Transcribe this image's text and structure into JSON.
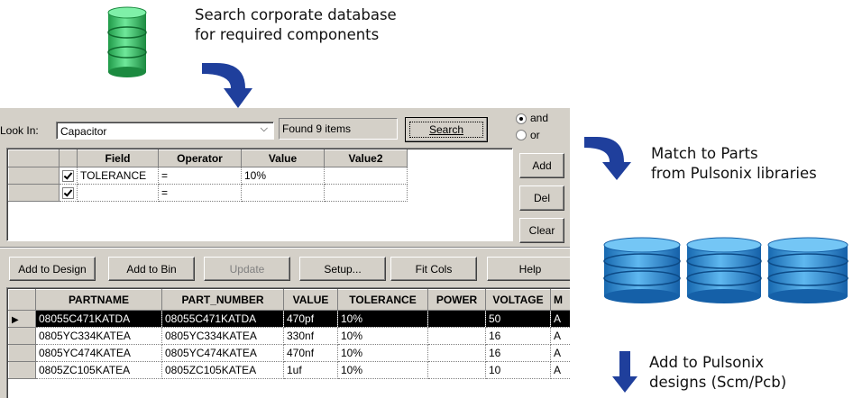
{
  "top_caption": [
    "Search corporate database",
    "for required components"
  ],
  "match_caption": [
    "Match  to Parts",
    "from Pulsonix libraries"
  ],
  "add_caption": [
    "Add to Pulsonix",
    "designs (Scm/Pcb)"
  ],
  "colors": {
    "db_green": "#33cc66",
    "db_blue": "#2a8fd8",
    "arrow_blue": "#1f3f9c",
    "dialog_bg": "#d4d0c8"
  },
  "dialog": {
    "look_in_label": "Look In:",
    "look_in_value": "Capacitor",
    "found_text": "Found 9 items",
    "search_button": "Search",
    "radio_and": "and",
    "radio_or": "or",
    "add_button": "Add",
    "del_button": "Del",
    "clear_button": "Clear",
    "criteria": {
      "headers": [
        "Field",
        "Operator",
        "Value",
        "Value2"
      ],
      "rows": [
        {
          "field": "TOLERANCE",
          "operator": "=",
          "value": "10%",
          "value2": ""
        },
        {
          "field": "",
          "operator": "=",
          "value": "",
          "value2": ""
        }
      ]
    },
    "toolbar": {
      "add_to_design": "Add to Design",
      "add_to_bin": "Add to Bin",
      "update": "Update",
      "setup": "Setup...",
      "fit_cols": "Fit Cols",
      "help": "Help"
    },
    "results": {
      "headers": [
        "PARTNAME",
        "PART_NUMBER",
        "VALUE",
        "TOLERANCE",
        "POWER",
        "VOLTAGE",
        "M"
      ],
      "rows": [
        [
          "08055C471KATDA",
          "08055C471KATDA",
          "470pf",
          "10%",
          "",
          "50",
          "A"
        ],
        [
          "0805YC334KATEA",
          "0805YC334KATEA",
          "330nf",
          "10%",
          "",
          "16",
          "A"
        ],
        [
          "0805YC474KATEA",
          "0805YC474KATEA",
          "470nf",
          "10%",
          "",
          "16",
          "A"
        ],
        [
          "0805ZC105KATEA",
          "0805ZC105KATEA",
          "1uf",
          "10%",
          "",
          "10",
          "A"
        ]
      ]
    }
  }
}
